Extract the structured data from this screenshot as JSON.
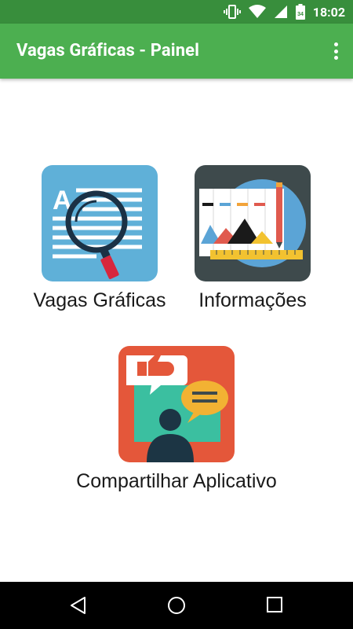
{
  "status_bar": {
    "time": "18:02",
    "icons": [
      "vibrate-icon",
      "wifi-icon",
      "signal-icon",
      "battery-icon"
    ],
    "battery_level": "34"
  },
  "app_bar": {
    "title": "Vagas Gráficas - Painel",
    "menu_icon": "overflow-menu-icon"
  },
  "tiles": [
    {
      "label": "Vagas Gráficas",
      "icon": "document-search-icon"
    },
    {
      "label": "Informações",
      "icon": "chart-info-icon"
    },
    {
      "label": "Compartilhar Aplicativo",
      "icon": "share-feedback-icon"
    }
  ],
  "nav_bar": {
    "buttons": [
      "back-icon",
      "home-icon",
      "recents-icon"
    ]
  },
  "colors": {
    "status_bar": "#388E3C",
    "app_bar": "#4CAF50",
    "nav_bar": "#000000"
  }
}
